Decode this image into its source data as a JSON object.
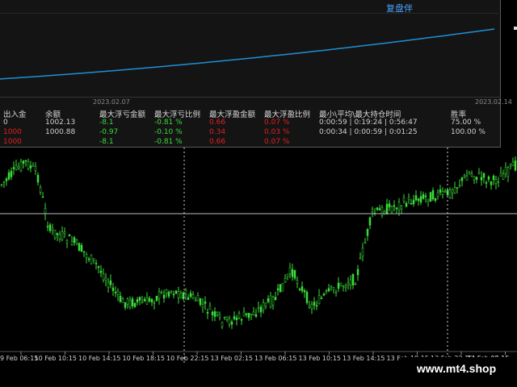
{
  "panel": {
    "title": "复盘伴",
    "date_start": "2023.02.07",
    "date_end": "2023.02.14",
    "headers": [
      "出入金",
      "余额",
      "最大浮亏金额",
      "最大浮亏比例",
      "最大浮盈金额",
      "最大浮盈比例",
      "最小\\平均\\最大持仓时间",
      "胜率"
    ],
    "rows": [
      {
        "deposit": "0",
        "balance": "1002.13",
        "max_float_loss": "-8.1",
        "max_float_loss_pct": "-0.81 %",
        "max_float_profit": "0.66",
        "max_float_profit_pct": "0.07 %",
        "hold_time": "0:00:59 | 0:19:24 | 0:56:47",
        "win_rate": "75.00 %"
      },
      {
        "deposit": "1000",
        "balance": "1000.88",
        "max_float_loss": "-0.97",
        "max_float_loss_pct": "-0.10 %",
        "max_float_profit": "0.34",
        "max_float_profit_pct": "0.03 %",
        "hold_time": "0:00:34 | 0:00:59 | 0:01:25",
        "win_rate": "100.00 %"
      },
      {
        "deposit": "1000",
        "balance": "",
        "max_float_loss": "-8.1",
        "max_float_loss_pct": "-0.81 %",
        "max_float_profit": "0.66",
        "max_float_profit_pct": "0.07 %",
        "hold_time": "",
        "win_rate": ""
      }
    ],
    "colors": {
      "equity_line": "#1e90d6",
      "title": "#4aa3ff",
      "loss": "#3adc3a",
      "profit": "#e02020"
    }
  },
  "chart": {
    "x_labels": [
      "9 Feb 06:15",
      "10 Feb 10:15",
      "10 Feb 14:15",
      "10 Feb 18:15",
      "10 Feb 22:15",
      "13 Feb 02:15",
      "13 Feb 06:15",
      "13 Feb 10:15",
      "13 Feb 14:15",
      "13 Feb 18:15",
      "13 Feb 22:15",
      "14 Feb 02:15",
      "14 Feb 06:15"
    ],
    "candle_color": "#3adc3a",
    "watermark": "www.mt4.shop"
  }
}
